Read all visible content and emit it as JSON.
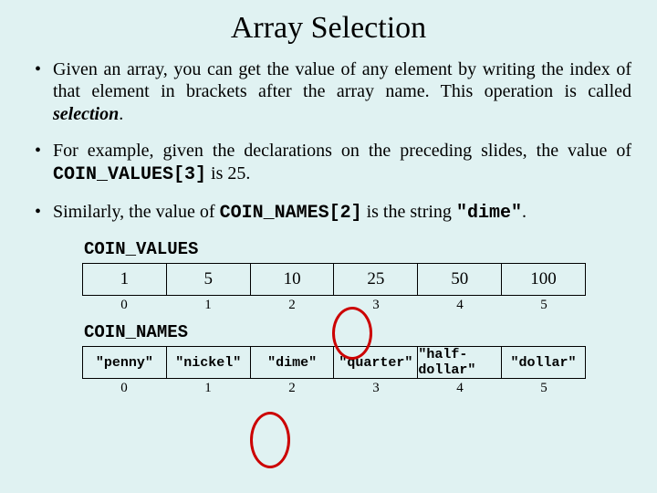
{
  "title": "Array Selection",
  "bullet1": {
    "pre": "Given an array, you can get the value of any element by writing the index of that element in brackets after the array name.  This operation is called ",
    "sel": "selection",
    "post": "."
  },
  "bullet2": {
    "pre": "For example, given the declarations on the preceding slides, the value of ",
    "code": "COIN_VALUES[3]",
    "post": " is 25."
  },
  "bullet3": {
    "pre": "Similarly, the value of ",
    "code": "COIN_NAMES[2]",
    "mid": " is the string ",
    "str": "\"dime\"",
    "post": "."
  },
  "coin_values_label": "COIN_VALUES",
  "coin_values": [
    "1",
    "5",
    "10",
    "25",
    "50",
    "100"
  ],
  "coin_values_idx": [
    "0",
    "1",
    "2",
    "3",
    "4",
    "5"
  ],
  "coin_names_label": "COIN_NAMES",
  "coin_names": [
    "\"penny\"",
    "\"nickel\"",
    "\"dime\"",
    "\"quarter\"",
    "\"half-dollar\"",
    "\"dollar\""
  ],
  "coin_names_idx": [
    "0",
    "1",
    "2",
    "3",
    "4",
    "5"
  ]
}
